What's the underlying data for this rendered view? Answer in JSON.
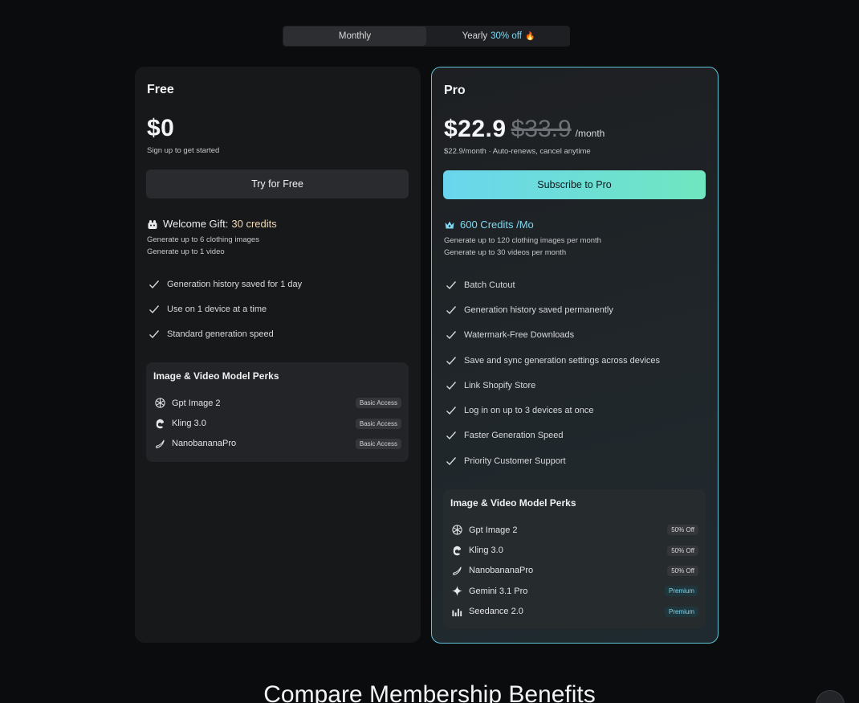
{
  "billing_toggle": {
    "monthly_label": "Monthly",
    "yearly_label": "Yearly",
    "yearly_discount": "30% off"
  },
  "free": {
    "name": "Free",
    "price": "$0",
    "price_sub": "Sign up to get started",
    "cta": "Try for Free",
    "gift_label": "Welcome Gift:",
    "gift_value": "30 credits",
    "sub_lines": [
      "Generate up to 6 clothing images",
      "Generate up to 1 video"
    ],
    "features": [
      "Generation history saved for 1 day",
      "Use on 1 device at a time",
      "Standard generation speed"
    ],
    "perks_title": "Image & Video Model Perks",
    "perks": [
      {
        "name": "Gpt Image 2",
        "badge": "Basic Access",
        "icon": "openai-icon"
      },
      {
        "name": "Kling 3.0",
        "badge": "Basic Access",
        "icon": "kling-icon"
      },
      {
        "name": "NanobananaPro",
        "badge": "Basic Access",
        "icon": "banana-icon"
      }
    ]
  },
  "pro": {
    "name": "Pro",
    "price": "$22.9",
    "price_old": "$33.9",
    "per": "/month",
    "price_sub": "$22.9/month · Auto-renews, cancel anytime",
    "cta": "Subscribe to Pro",
    "credits_label": "600 Credits /Mo",
    "sub_lines": [
      "Generate up to 120 clothing images per month",
      "Generate up to 30 videos per month"
    ],
    "features": [
      "Batch Cutout",
      "Generation history saved permanently",
      "Watermark-Free Downloads",
      "Save and sync generation settings across devices",
      "Link Shopify Store",
      "Log in on up to 3 devices at once",
      "Faster Generation Speed",
      "Priority Customer Support"
    ],
    "perks_title": "Image & Video Model Perks",
    "perks": [
      {
        "name": "Gpt Image 2",
        "badge": "50% Off",
        "icon": "openai-icon"
      },
      {
        "name": "Kling 3.0",
        "badge": "50% Off",
        "icon": "kling-icon"
      },
      {
        "name": "NanobananaPro",
        "badge": "50% Off",
        "icon": "banana-icon"
      },
      {
        "name": "Gemini 3.1 Pro",
        "badge": "Premium",
        "icon": "gemini-sparkle-icon"
      },
      {
        "name": "Seedance 2.0",
        "badge": "Premium",
        "icon": "seedance-bars-icon"
      }
    ]
  },
  "compare_title": "Compare Membership Benefits",
  "colors": {
    "accent_cyan": "#7fd8f0",
    "accent_green": "#70e6bf",
    "pro_border": "#5fc4d6"
  }
}
